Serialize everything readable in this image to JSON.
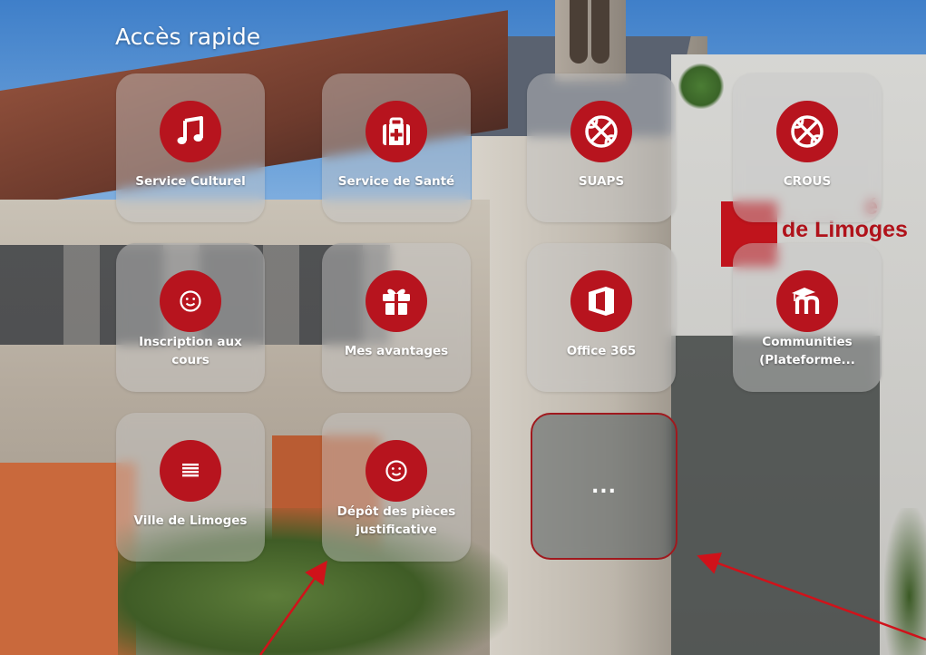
{
  "section_title": "Accès rapide",
  "tiles": [
    {
      "label": "Service Culturel",
      "icon": "music-note-icon"
    },
    {
      "label": "Service de Santé",
      "icon": "medical-kit-icon"
    },
    {
      "label": "SUAPS",
      "icon": "basketball-icon"
    },
    {
      "label": "CROUS",
      "icon": "basketball-icon"
    },
    {
      "label": "Inscription aux cours",
      "icon": "smiley-icon"
    },
    {
      "label": "Mes avantages",
      "icon": "gift-icon"
    },
    {
      "label": "Office 365",
      "icon": "office-365-icon"
    },
    {
      "label": "Communities (Plateforme...",
      "icon": "moodle-icon"
    },
    {
      "label": "Ville de Limoges",
      "icon": "list-icon"
    },
    {
      "label": "Dépôt des pièces justificative",
      "icon": "smiley-icon"
    }
  ],
  "more_button": {
    "label": "..."
  },
  "background_text": {
    "line1": "é",
    "line2": "de Limoges"
  },
  "colors": {
    "accent": "#b7141e",
    "highlight_border": "#a0191e",
    "annotation_arrow": "#d0121a"
  }
}
